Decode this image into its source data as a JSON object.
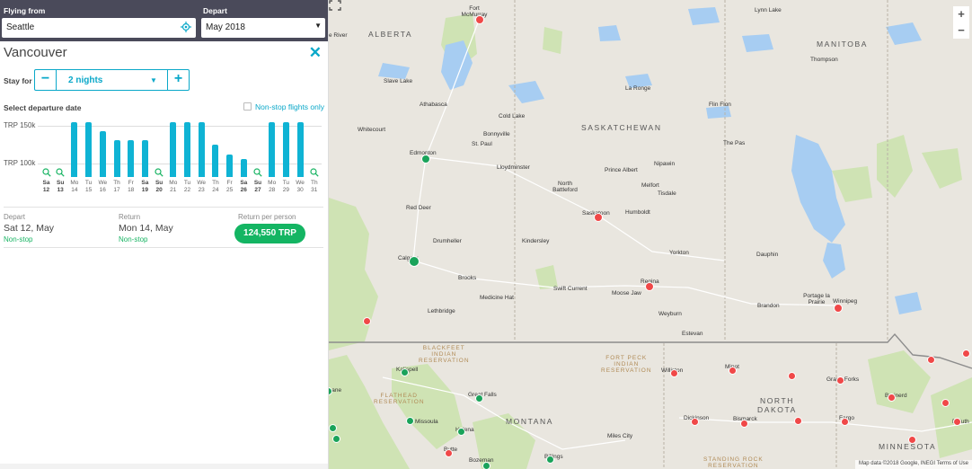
{
  "search": {
    "from_label": "Flying from",
    "from_value": "Seattle",
    "depart_label": "Depart",
    "depart_value": "May 2018"
  },
  "destination": {
    "name": "Vancouver"
  },
  "stay": {
    "label": "Stay for",
    "value": "2 nights"
  },
  "calendar": {
    "select_label": "Select departure date",
    "nonstop_label": "Non-stop flights only",
    "y_labels": [
      "TRP 150k",
      "TRP 100k"
    ],
    "bar_color": "#0fb3d4"
  },
  "chart_data": {
    "type": "bar",
    "categories": [
      "Sa 12",
      "Su 13",
      "Mo 14",
      "Tu 15",
      "We 16",
      "Th 17",
      "Fr 18",
      "Sa 19",
      "Su 20",
      "Mo 21",
      "Tu 22",
      "We 23",
      "Th 24",
      "Fr 25",
      "Sa 26",
      "Su 27",
      "Mo 28",
      "Tu 29",
      "We 30",
      "Th 31"
    ],
    "days": [
      {
        "dow": "Sa",
        "day": "12",
        "price": null,
        "weekend": true
      },
      {
        "dow": "Su",
        "day": "13",
        "price": null,
        "weekend": true
      },
      {
        "dow": "Mo",
        "day": "14",
        "price": 150,
        "weekend": false
      },
      {
        "dow": "Tu",
        "day": "15",
        "price": 150,
        "weekend": false
      },
      {
        "dow": "We",
        "day": "16",
        "price": 140,
        "weekend": false
      },
      {
        "dow": "Th",
        "day": "17",
        "price": 130,
        "weekend": false
      },
      {
        "dow": "Fr",
        "day": "18",
        "price": 130,
        "weekend": false
      },
      {
        "dow": "Sa",
        "day": "19",
        "price": 130,
        "weekend": true
      },
      {
        "dow": "Su",
        "day": "20",
        "price": null,
        "weekend": true
      },
      {
        "dow": "Mo",
        "day": "21",
        "price": 150,
        "weekend": false
      },
      {
        "dow": "Tu",
        "day": "22",
        "price": 150,
        "weekend": false
      },
      {
        "dow": "We",
        "day": "23",
        "price": 150,
        "weekend": false
      },
      {
        "dow": "Th",
        "day": "24",
        "price": 125,
        "weekend": false
      },
      {
        "dow": "Fr",
        "day": "25",
        "price": 115,
        "weekend": false
      },
      {
        "dow": "Sa",
        "day": "26",
        "price": 110,
        "weekend": true
      },
      {
        "dow": "Su",
        "day": "27",
        "price": null,
        "weekend": true
      },
      {
        "dow": "Mo",
        "day": "28",
        "price": 150,
        "weekend": false
      },
      {
        "dow": "Tu",
        "day": "29",
        "price": 150,
        "weekend": false
      },
      {
        "dow": "We",
        "day": "30",
        "price": 150,
        "weekend": false
      },
      {
        "dow": "Th",
        "day": "31",
        "price": null,
        "weekend": false
      }
    ],
    "ylabel": "TRP",
    "ylim": [
      90,
      150
    ],
    "unit": "k"
  },
  "summary": {
    "depart_head": "Depart",
    "depart_value": "Sat 12, May",
    "depart_stop": "Non-stop",
    "return_head": "Return",
    "return_value": "Mon 14, May",
    "return_stop": "Non-stop",
    "price_head": "Return per person",
    "price_value": "124,550 TRP"
  },
  "map": {
    "provinces": [
      "ALBERTA",
      "SASKATCHEWAN",
      "MANITOBA",
      "MONTANA",
      "NORTH DAKOTA",
      "MINNESOTA"
    ],
    "reservations": [
      [
        "BLACKFEET",
        "INDIAN",
        "RESERVATION"
      ],
      [
        "FLATHEAD",
        "RESERVATION"
      ],
      [
        "FORT PECK",
        "INDIAN",
        "RESERVATION"
      ],
      [
        "STANDING ROCK",
        "RESERVATION"
      ]
    ],
    "places": [
      "Fort McMurray",
      "Lynn Lake",
      "e River",
      "Slave Lake",
      "La Ronge",
      "Thompson",
      "Athabasca",
      "Cold Lake",
      "Flin Flon",
      "Whitecourt",
      "Bonnyville",
      "St. Paul",
      "The Pas",
      "Edmonton",
      "Lloydminster",
      "Prince Albert",
      "Nipawin",
      "North Battleford",
      "Melfort",
      "Tisdale",
      "Red Deer",
      "Saskatoon",
      "Humboldt",
      "Drumheller",
      "Kindersley",
      "Yorkton",
      "Dauphin",
      "Calgary",
      "Brooks",
      "Regina",
      "Swift Current",
      "Moose Jaw",
      "Medicine Hat",
      "Portage la Prairie",
      "Winnipeg",
      "Brandon",
      "Lethbridge",
      "Weyburn",
      "Estevan",
      "Kalispell",
      "Williston",
      "Minot",
      "Grand Forks",
      "Great Falls",
      "Missoula",
      "Helena",
      "Dickinson",
      "Bismarck",
      "Fargo",
      "Miles City",
      "Butte",
      "Bozeman",
      "Billings",
      "Brainerd",
      "Duluth",
      "kane"
    ],
    "zoom_in": "+",
    "zoom_out": "−",
    "attribution": "Map data ©2018 Google, INEGI   Terms of Use"
  }
}
